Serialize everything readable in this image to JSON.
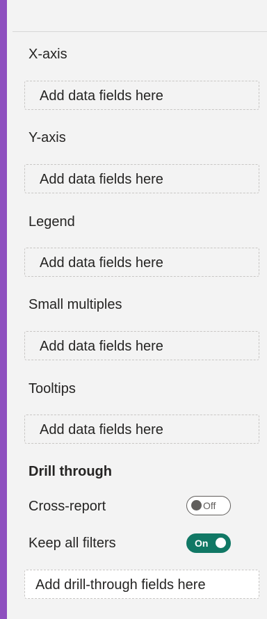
{
  "colors": {
    "accent_bar": "#8e4fbf",
    "toggle_on": "#117865",
    "panel_bg": "#f3f3f3"
  },
  "wells": [
    {
      "label": "X-axis",
      "placeholder": "Add data fields here"
    },
    {
      "label": "Y-axis",
      "placeholder": "Add data fields here"
    },
    {
      "label": "Legend",
      "placeholder": "Add data fields here"
    },
    {
      "label": "Small multiples",
      "placeholder": "Add data fields here"
    },
    {
      "label": "Tooltips",
      "placeholder": "Add data fields here"
    }
  ],
  "drill_through": {
    "title": "Drill through",
    "cross_report": {
      "label": "Cross-report",
      "state": "Off"
    },
    "keep_all_filters": {
      "label": "Keep all filters",
      "state": "On"
    },
    "placeholder": "Add drill-through fields here"
  }
}
